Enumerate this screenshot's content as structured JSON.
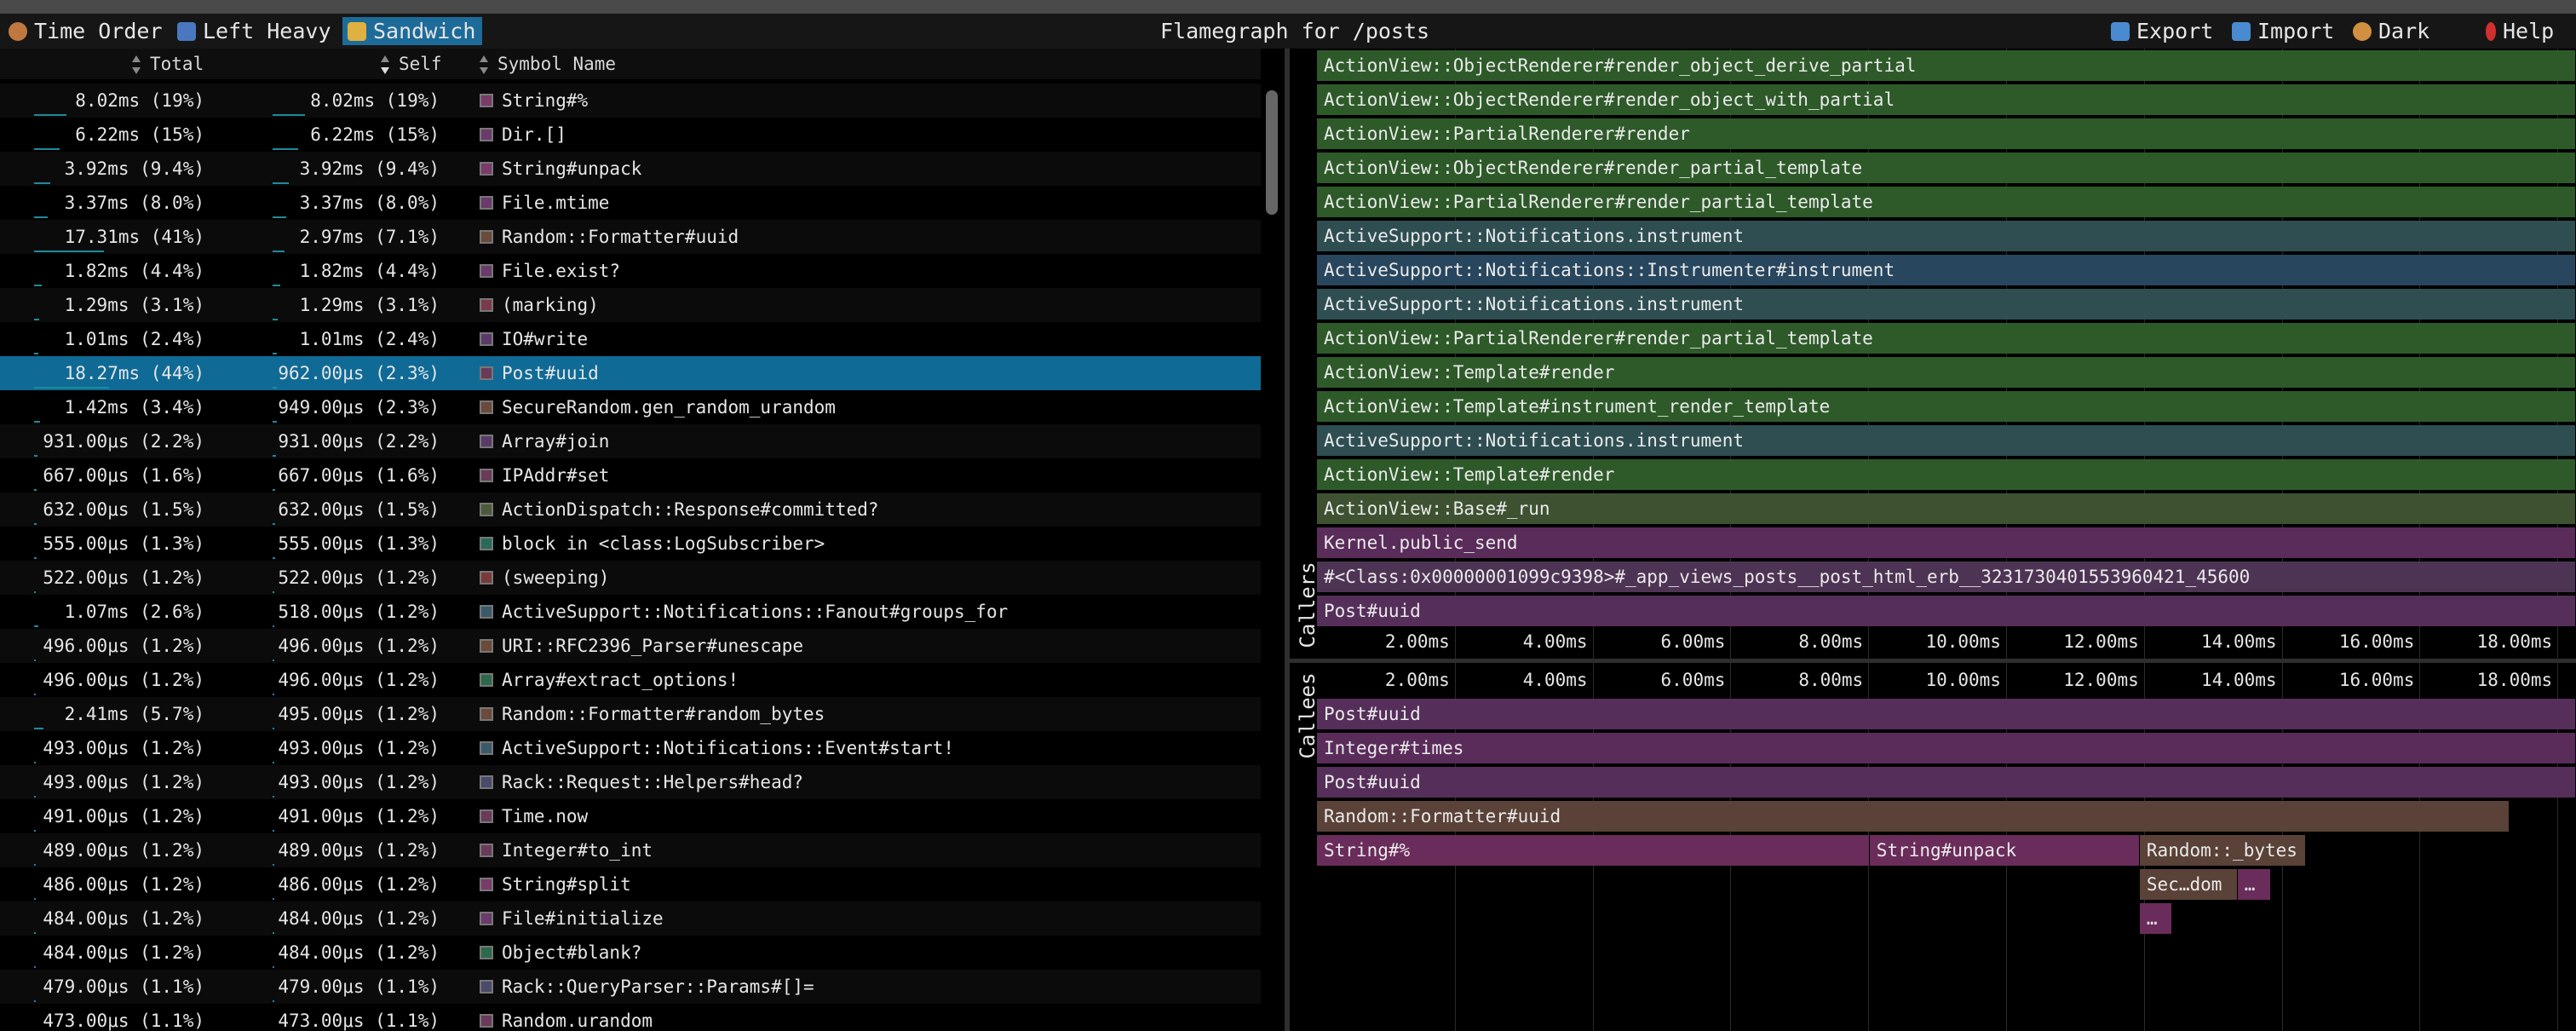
{
  "toolbar": {
    "buttons": [
      {
        "label": "Time Order",
        "icon": "clock-icon",
        "color": "#c07840"
      },
      {
        "label": "Left Heavy",
        "icon": "left-arrow-icon",
        "color": "#4a78c0"
      },
      {
        "label": "Sandwich",
        "icon": "sandwich-icon",
        "color": "#e0b040"
      }
    ],
    "title": "Flamegraph for /posts",
    "right_buttons": [
      {
        "label": "Export",
        "icon": "export-icon",
        "color": "#4a8ad0"
      },
      {
        "label": "Import",
        "icon": "import-icon",
        "color": "#4a8ad0"
      },
      {
        "label": "Dark",
        "icon": "palette-icon",
        "color": "#d09040"
      },
      {
        "label": "Help",
        "icon": "help-icon",
        "color": "#d03030"
      }
    ]
  },
  "table": {
    "headers": {
      "total": "Total",
      "self": "Self",
      "symbol": "Symbol Name"
    },
    "rows": [
      {
        "total": "8.02ms (19%)",
        "self": "8.02ms (19%)",
        "symbol": "String#%",
        "tp": 0.19,
        "sp": 0.19,
        "color": "#7a3a6a"
      },
      {
        "total": "6.22ms (15%)",
        "self": "6.22ms (15%)",
        "symbol": "Dir.[]",
        "tp": 0.15,
        "sp": 0.15,
        "color": "#6a3a6a"
      },
      {
        "total": "3.92ms (9.4%)",
        "self": "3.92ms (9.4%)",
        "symbol": "String#unpack",
        "tp": 0.094,
        "sp": 0.094,
        "color": "#7a3a6a"
      },
      {
        "total": "3.37ms (8.0%)",
        "self": "3.37ms (8.0%)",
        "symbol": "File.mtime",
        "tp": 0.08,
        "sp": 0.08,
        "color": "#6a3a6a"
      },
      {
        "total": "17.31ms (41%)",
        "self": "2.97ms (7.1%)",
        "symbol": "Random::Formatter#uuid",
        "tp": 0.41,
        "sp": 0.071,
        "color": "#6a4a3a"
      },
      {
        "total": "1.82ms (4.4%)",
        "self": "1.82ms (4.4%)",
        "symbol": "File.exist?",
        "tp": 0.044,
        "sp": 0.044,
        "color": "#6a3a6a"
      },
      {
        "total": "1.29ms (3.1%)",
        "self": "1.29ms (3.1%)",
        "symbol": "(marking)",
        "tp": 0.031,
        "sp": 0.031,
        "color": "#7a3a4a"
      },
      {
        "total": "1.01ms (2.4%)",
        "self": "1.01ms (2.4%)",
        "symbol": "IO#write",
        "tp": 0.024,
        "sp": 0.024,
        "color": "#5a3a6a"
      },
      {
        "total": "18.27ms (44%)",
        "self": "962.00μs (2.3%)",
        "symbol": "Post#uuid",
        "tp": 0.44,
        "sp": 0.023,
        "color": "#6a3a5a",
        "selected": true
      },
      {
        "total": "1.42ms (3.4%)",
        "self": "949.00μs (2.3%)",
        "symbol": "SecureRandom.gen_random_urandom",
        "tp": 0.034,
        "sp": 0.023,
        "color": "#6a4a3a"
      },
      {
        "total": "931.00μs (2.2%)",
        "self": "931.00μs (2.2%)",
        "symbol": "Array#join",
        "tp": 0.022,
        "sp": 0.022,
        "color": "#5a3a6a"
      },
      {
        "total": "667.00μs (1.6%)",
        "self": "667.00μs (1.6%)",
        "symbol": "IPAddr#set",
        "tp": 0.016,
        "sp": 0.016,
        "color": "#6a3a5a"
      },
      {
        "total": "632.00μs (1.5%)",
        "self": "632.00μs (1.5%)",
        "symbol": "ActionDispatch::Response#committed?",
        "tp": 0.015,
        "sp": 0.015,
        "color": "#4a5a3a"
      },
      {
        "total": "555.00μs (1.3%)",
        "self": "555.00μs (1.3%)",
        "symbol": "block in <class:LogSubscriber>",
        "tp": 0.013,
        "sp": 0.013,
        "color": "#2a6a5a"
      },
      {
        "total": "522.00μs (1.2%)",
        "self": "522.00μs (1.2%)",
        "symbol": "(sweeping)",
        "tp": 0.012,
        "sp": 0.012,
        "color": "#7a3a3a"
      },
      {
        "total": "1.07ms (2.6%)",
        "self": "518.00μs (1.2%)",
        "symbol": "ActiveSupport::Notifications::Fanout#groups_for",
        "tp": 0.026,
        "sp": 0.012,
        "color": "#3a5a6a"
      },
      {
        "total": "496.00μs (1.2%)",
        "self": "496.00μs (1.2%)",
        "symbol": "URI::RFC2396_Parser#unescape",
        "tp": 0.012,
        "sp": 0.012,
        "color": "#6a4a3a"
      },
      {
        "total": "496.00μs (1.2%)",
        "self": "496.00μs (1.2%)",
        "symbol": "Array#extract_options!",
        "tp": 0.012,
        "sp": 0.012,
        "color": "#2a6a4a"
      },
      {
        "total": "2.41ms (5.7%)",
        "self": "495.00μs (1.2%)",
        "symbol": "Random::Formatter#random_bytes",
        "tp": 0.057,
        "sp": 0.012,
        "color": "#6a4a3a"
      },
      {
        "total": "493.00μs (1.2%)",
        "self": "493.00μs (1.2%)",
        "symbol": "ActiveSupport::Notifications::Event#start!",
        "tp": 0.012,
        "sp": 0.012,
        "color": "#3a5a6a"
      },
      {
        "total": "493.00μs (1.2%)",
        "self": "493.00μs (1.2%)",
        "symbol": "Rack::Request::Helpers#head?",
        "tp": 0.012,
        "sp": 0.012,
        "color": "#4a4a6a"
      },
      {
        "total": "491.00μs (1.2%)",
        "self": "491.00μs (1.2%)",
        "symbol": "Time.now",
        "tp": 0.012,
        "sp": 0.012,
        "color": "#6a3a5a"
      },
      {
        "total": "489.00μs (1.2%)",
        "self": "489.00μs (1.2%)",
        "symbol": "Integer#to_int",
        "tp": 0.012,
        "sp": 0.012,
        "color": "#6a3a5a"
      },
      {
        "total": "486.00μs (1.2%)",
        "self": "486.00μs (1.2%)",
        "symbol": "String#split",
        "tp": 0.012,
        "sp": 0.012,
        "color": "#7a3a6a"
      },
      {
        "total": "484.00μs (1.2%)",
        "self": "484.00μs (1.2%)",
        "symbol": "File#initialize",
        "tp": 0.012,
        "sp": 0.012,
        "color": "#6a3a6a"
      },
      {
        "total": "484.00μs (1.2%)",
        "self": "484.00μs (1.2%)",
        "symbol": "Object#blank?",
        "tp": 0.012,
        "sp": 0.012,
        "color": "#2a6a4a"
      },
      {
        "total": "479.00μs (1.1%)",
        "self": "479.00μs (1.1%)",
        "symbol": "Rack::QueryParser::Params#[]=",
        "tp": 0.011,
        "sp": 0.011,
        "color": "#4a4a6a"
      },
      {
        "total": "473.00μs (1.1%)",
        "self": "473.00μs (1.1%)",
        "symbol": "Random.urandom",
        "tp": 0.011,
        "sp": 0.011,
        "color": "#6a3a5a"
      }
    ]
  },
  "callers_label": "Callers",
  "callees_label": "Callees",
  "axis": {
    "ticks": [
      "2.00ms",
      "4.00ms",
      "6.00ms",
      "8.00ms",
      "10.00ms",
      "12.00ms",
      "14.00ms",
      "16.00ms",
      "18.00ms"
    ],
    "tick_values_ms": [
      2,
      4,
      6,
      8,
      10,
      12,
      14,
      16,
      18
    ],
    "total_ms": 18.27
  },
  "callers": [
    {
      "label": "ActionView::ObjectRenderer#render_object_derive_partial",
      "color": "#2e5a2a"
    },
    {
      "label": "ActionView::ObjectRenderer#render_object_with_partial",
      "color": "#2e5a2a"
    },
    {
      "label": "ActionView::PartialRenderer#render",
      "color": "#2e5a2a"
    },
    {
      "label": "ActionView::ObjectRenderer#render_partial_template",
      "color": "#2e5a2a"
    },
    {
      "label": "ActionView::PartialRenderer#render_partial_template",
      "color": "#2e5a2a"
    },
    {
      "label": "ActiveSupport::Notifications.instrument",
      "color": "#2e4e52"
    },
    {
      "label": "ActiveSupport::Notifications::Instrumenter#instrument",
      "color": "#28465e"
    },
    {
      "label": "ActiveSupport::Notifications.instrument",
      "color": "#2e4e52"
    },
    {
      "label": "ActionView::PartialRenderer#render_partial_template",
      "color": "#2e5a2a"
    },
    {
      "label": "ActionView::Template#render",
      "color": "#2e5a2a"
    },
    {
      "label": "ActionView::Template#instrument_render_template",
      "color": "#2e5a2a"
    },
    {
      "label": "ActiveSupport::Notifications.instrument",
      "color": "#2e4e52"
    },
    {
      "label": "ActionView::Template#render",
      "color": "#2e5a2a"
    },
    {
      "label": "ActionView::Base#_run",
      "color": "#3e5232"
    },
    {
      "label": "Kernel.public_send",
      "color": "#5a2c5a"
    },
    {
      "label": "#<Class:0x00000001099c9398>#_app_views_posts__post_html_erb__3231730401553960421_45600",
      "color": "#4e3454"
    },
    {
      "label": "Post#uuid",
      "color": "#552f5a"
    }
  ],
  "callees": [
    {
      "label": "Post#uuid",
      "start_ms": 0,
      "duration_ms": 18.27,
      "depth": 0,
      "color": "#552f5a"
    },
    {
      "label": "Integer#times",
      "start_ms": 0,
      "duration_ms": 18.27,
      "depth": 1,
      "color": "#5a2c5a"
    },
    {
      "label": "Post#uuid",
      "start_ms": 0,
      "duration_ms": 18.27,
      "depth": 2,
      "color": "#552f5a"
    },
    {
      "label": "Random::Formatter#uuid",
      "start_ms": 0,
      "duration_ms": 17.31,
      "depth": 3,
      "color": "#5a4238"
    },
    {
      "label": "String#%",
      "start_ms": 0,
      "duration_ms": 8.02,
      "depth": 4,
      "color": "#6a2c5a"
    },
    {
      "label": "String#unpack",
      "start_ms": 8.02,
      "duration_ms": 3.92,
      "depth": 4,
      "color": "#6a2c5a"
    },
    {
      "label": "Random::_bytes",
      "start_ms": 11.94,
      "duration_ms": 2.41,
      "depth": 4,
      "color": "#5a4238"
    },
    {
      "label": "Sec…dom",
      "start_ms": 11.94,
      "duration_ms": 1.42,
      "depth": 5,
      "color": "#5a4238"
    },
    {
      "label": "…",
      "start_ms": 13.36,
      "duration_ms": 0.49,
      "depth": 5,
      "color": "#6a2c5a"
    },
    {
      "label": "…",
      "start_ms": 11.94,
      "duration_ms": 0.47,
      "depth": 6,
      "color": "#6a2c5a"
    }
  ]
}
